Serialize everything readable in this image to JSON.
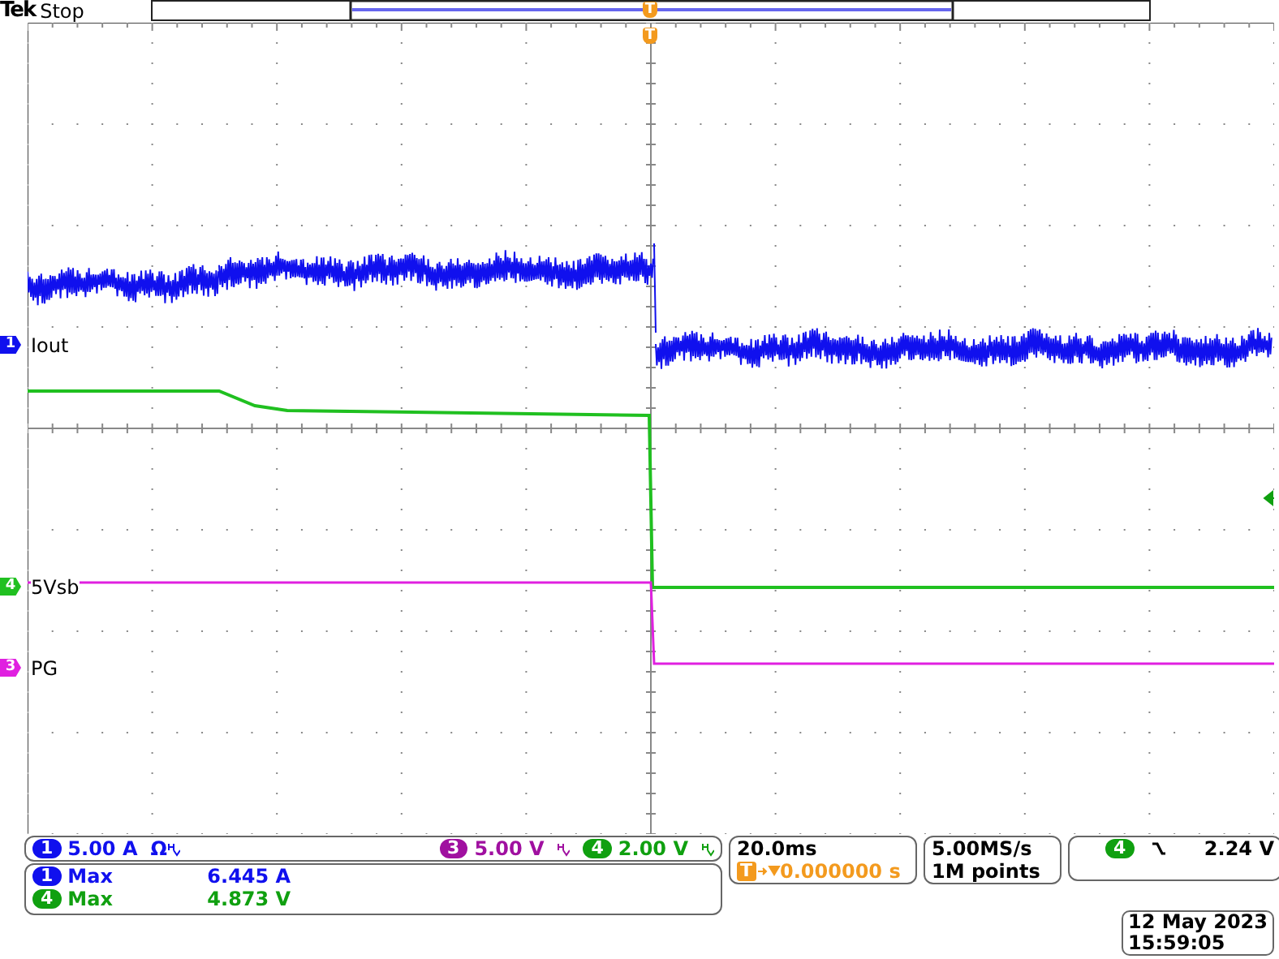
{
  "header": {
    "brand": "Tek",
    "state": "Stop"
  },
  "trigger_position": {
    "label": "T"
  },
  "trigger_time_marker": {
    "label": "T"
  },
  "channels": [
    {
      "number": "1",
      "label": "Iout",
      "color": "#1010ee"
    },
    {
      "number": "4",
      "label": "5Vsb",
      "color": "#20c020"
    },
    {
      "number": "3",
      "label": "PG",
      "color": "#e020e0"
    }
  ],
  "channel_readouts": [
    {
      "number": "1",
      "value": "5.00 A",
      "suffix": "Ω",
      "color": "#1010ee"
    },
    {
      "number": "3",
      "value": "5.00 V",
      "color": "#a010a0"
    },
    {
      "number": "4",
      "value": "2.00 V",
      "color": "#10a010"
    }
  ],
  "measurements": [
    {
      "number": "1",
      "name": "Max",
      "value": "6.445 A",
      "color": "#1010ee"
    },
    {
      "number": "4",
      "name": "Max",
      "value": "4.873 V",
      "color": "#10a010"
    }
  ],
  "horizontal": {
    "scale": "20.0ms",
    "delay_marker": "T",
    "delay": "0.000000 s"
  },
  "acquisition": {
    "sample_rate": "5.00MS/s",
    "record_length": "1M points"
  },
  "trigger": {
    "source": "4",
    "falling_edge": true,
    "level": "2.24 V",
    "color": "#10a010"
  },
  "timestamp": {
    "date": "12 May 2023",
    "time": "15:59:05"
  }
}
